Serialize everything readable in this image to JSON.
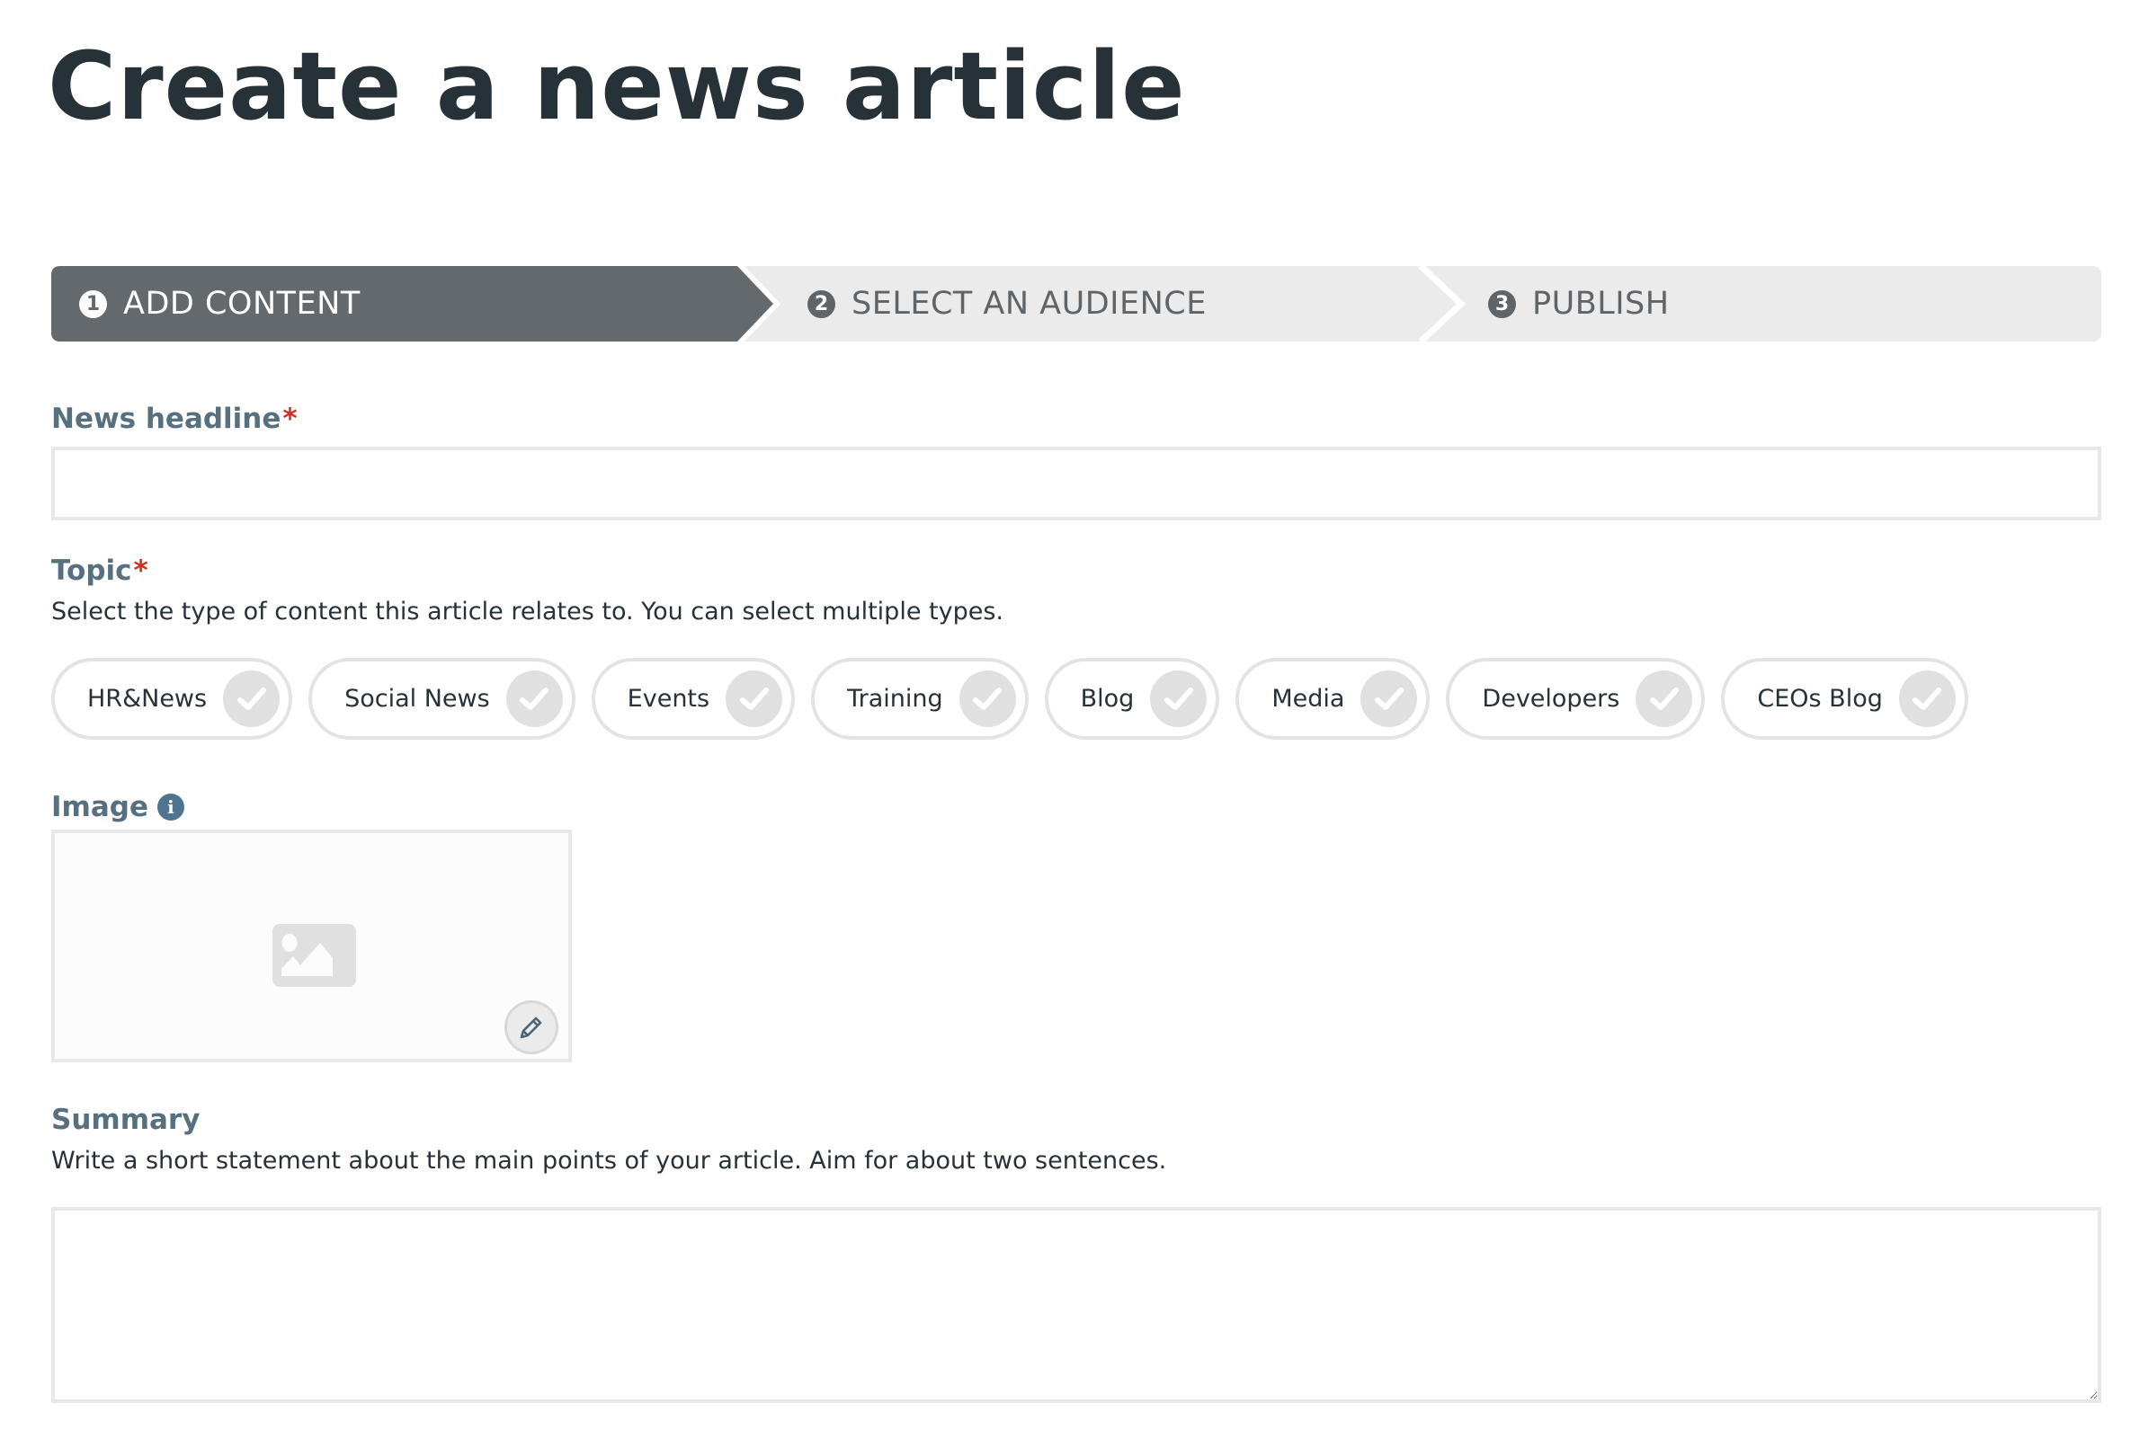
{
  "page": {
    "title": "Create a news article"
  },
  "stepper": {
    "steps": [
      {
        "number": "1",
        "label": "ADD CONTENT",
        "state": "active"
      },
      {
        "number": "2",
        "label": "SELECT AN AUDIENCE",
        "state": "inactive"
      },
      {
        "number": "3",
        "label": "PUBLISH",
        "state": "inactive"
      }
    ],
    "colors": {
      "active_bg": "#64696d",
      "inactive_bg": "#ebebeb",
      "active_text": "#ffffff",
      "inactive_text": "#5f6468"
    }
  },
  "form": {
    "required_marker": "*",
    "headline": {
      "label": "News headline",
      "required": true,
      "value": "",
      "placeholder": ""
    },
    "topic": {
      "label": "Topic",
      "required": true,
      "help": "Select the type of content this article relates to. You can select multiple types.",
      "options": [
        {
          "label": "HR&News",
          "selected": false
        },
        {
          "label": "Social News",
          "selected": false
        },
        {
          "label": "Events",
          "selected": false
        },
        {
          "label": "Training",
          "selected": false
        },
        {
          "label": "Blog",
          "selected": false
        },
        {
          "label": "Media",
          "selected": false
        },
        {
          "label": "Developers",
          "selected": false
        },
        {
          "label": "CEOs Blog",
          "selected": false
        }
      ]
    },
    "image": {
      "label": "Image",
      "info_icon": "info-icon",
      "placeholder_icon": "image-placeholder-icon",
      "edit_icon": "pencil-icon"
    },
    "summary": {
      "label": "Summary",
      "help": "Write a short statement about the main points of your article. Aim for about two sentences.",
      "value": "",
      "placeholder": ""
    }
  },
  "colors": {
    "title": "#263238",
    "label": "#56707f",
    "required": "#d52b1e",
    "info_icon": "#4e7490",
    "border": "#e8e8e8",
    "check_circle": "#e0e0e0"
  }
}
